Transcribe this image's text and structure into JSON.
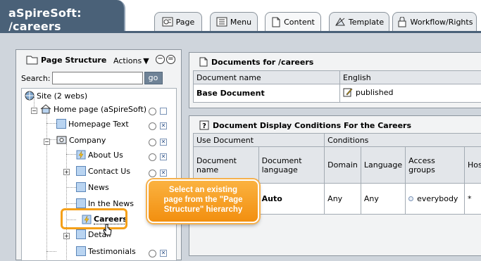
{
  "app": {
    "title": "aSpireSoft: /careers"
  },
  "tabs": [
    {
      "label": "Page",
      "icon": "page-edit-icon"
    },
    {
      "label": "Menu",
      "icon": "menu-icon"
    },
    {
      "label": "Content",
      "icon": "content-icon"
    },
    {
      "label": "Template",
      "icon": "template-icon"
    },
    {
      "label": "Workflow/Rights",
      "icon": "workflow-lock-icon"
    }
  ],
  "active_tab": "Content",
  "page_structure": {
    "title": "Page Structure",
    "actions_label": "Actions",
    "search_label": "Search:",
    "search_value": "",
    "go_label": "go",
    "tree": [
      {
        "label": "Site (2 webs)",
        "icon": "globe-icon"
      },
      {
        "label": "Home page (aSpireSoft)",
        "icon": "home-icon"
      },
      {
        "label": "Homepage Text",
        "icon": "page-icon"
      },
      {
        "label": "Company",
        "icon": "folder-page-icon"
      },
      {
        "label": "About Us",
        "icon": "lightning-page-icon"
      },
      {
        "label": "Contact Us",
        "icon": "page-icon"
      },
      {
        "label": "News",
        "icon": "page-icon"
      },
      {
        "label": "In the News",
        "icon": "page-icon"
      },
      {
        "label": "Careers",
        "icon": "lightning-page-icon"
      },
      {
        "label": "Detail",
        "icon": "page-icon"
      },
      {
        "label": "Testimonials",
        "icon": "page-icon"
      }
    ]
  },
  "documents": {
    "title": "Documents for /careers",
    "headers": [
      "Document name",
      "English"
    ],
    "rows": [
      {
        "name": "Base Document",
        "status": "published"
      }
    ]
  },
  "conditions": {
    "title": "Document Display Conditions For the Careers",
    "group_headers": [
      "Use Document",
      "Conditions"
    ],
    "headers": [
      "Document name",
      "Document language",
      "Domain",
      "Language",
      "Access groups",
      "Host"
    ],
    "rows": [
      {
        "name": "",
        "language": "Auto",
        "domain": "Any",
        "lang": "Any",
        "access": "everybody",
        "host": "*"
      }
    ]
  },
  "callout": {
    "line1": "Select an existing",
    "line2": "page from the \"Page",
    "line3": "Structure\" hierarchy"
  },
  "colors": {
    "header_bg": "#4a6178",
    "panel_bg": "#f2f3f4",
    "highlight": "#f5a019"
  }
}
